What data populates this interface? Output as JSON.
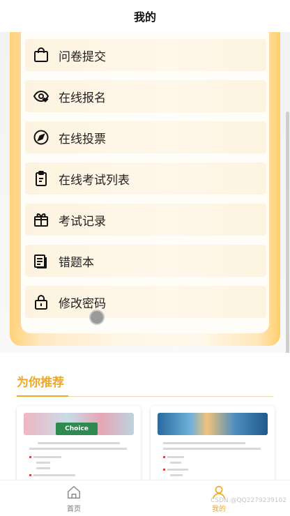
{
  "header": {
    "title": "我的"
  },
  "menu": [
    {
      "label": "问卷提交",
      "icon": "shopping-bag-icon"
    },
    {
      "label": "在线报名",
      "icon": "eye-heart-icon"
    },
    {
      "label": "在线投票",
      "icon": "compass-icon"
    },
    {
      "label": "在线考试列表",
      "icon": "clipboard-icon"
    },
    {
      "label": "考试记录",
      "icon": "gift-icon"
    },
    {
      "label": "错题本",
      "icon": "documents-icon"
    },
    {
      "label": "修改密码",
      "icon": "lock-icon"
    }
  ],
  "recommend": {
    "title": "为你推荐",
    "cards": [
      {
        "thumb_tag": "Choice",
        "thumb": "poll-banner-thumbnail"
      },
      {
        "thumb": "survey-banner-thumbnail"
      }
    ]
  },
  "tabbar": {
    "home_label": "首页",
    "mine_label": "我的",
    "watermark": "CSDN @QQ2279239102"
  },
  "colors": {
    "accent": "#f0a726",
    "menu_bg": "#fdf3e0",
    "card_border": "#ffd27a"
  }
}
